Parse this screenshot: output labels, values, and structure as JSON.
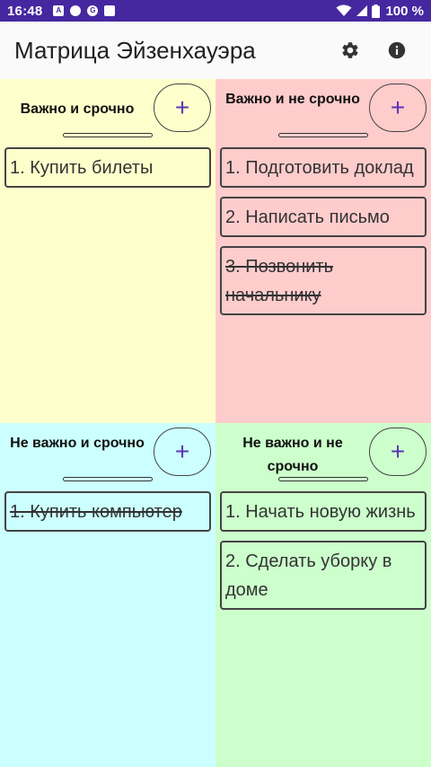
{
  "status_bar": {
    "time": "16:48",
    "notification_icons": [
      "a-icon",
      "chat-icon",
      "g-icon",
      "sd-card-icon"
    ],
    "battery_text": "100 %"
  },
  "app_bar": {
    "title": "Матрица Эйзенхауэра",
    "actions": [
      "settings-icon",
      "info-icon"
    ]
  },
  "quadrants": [
    {
      "title": "Важно и срочно",
      "background": "#ffffcc",
      "add_label": "+",
      "items": [
        {
          "text": "1.  Купить билеты",
          "done": false
        }
      ]
    },
    {
      "title": "Важно и не срочно",
      "background": "#ffcccc",
      "add_label": "+",
      "items": [
        {
          "text": "1. Подготовить доклад",
          "done": false
        },
        {
          "text": "2. Написать письмо",
          "done": false
        },
        {
          "text": "3. Позвонить начальнику",
          "done": true
        }
      ]
    },
    {
      "title": "Не важно и срочно",
      "background": "#ccffff",
      "add_label": "+",
      "items": [
        {
          "text": "1. Купить компьютер",
          "done": true
        }
      ]
    },
    {
      "title": "Не важно и не срочно",
      "background": "#ccffcc",
      "add_label": "+",
      "items": [
        {
          "text": "1. Начать новую жизнь",
          "done": false
        },
        {
          "text": "2. Сделать уборку в доме",
          "done": false
        }
      ]
    }
  ]
}
